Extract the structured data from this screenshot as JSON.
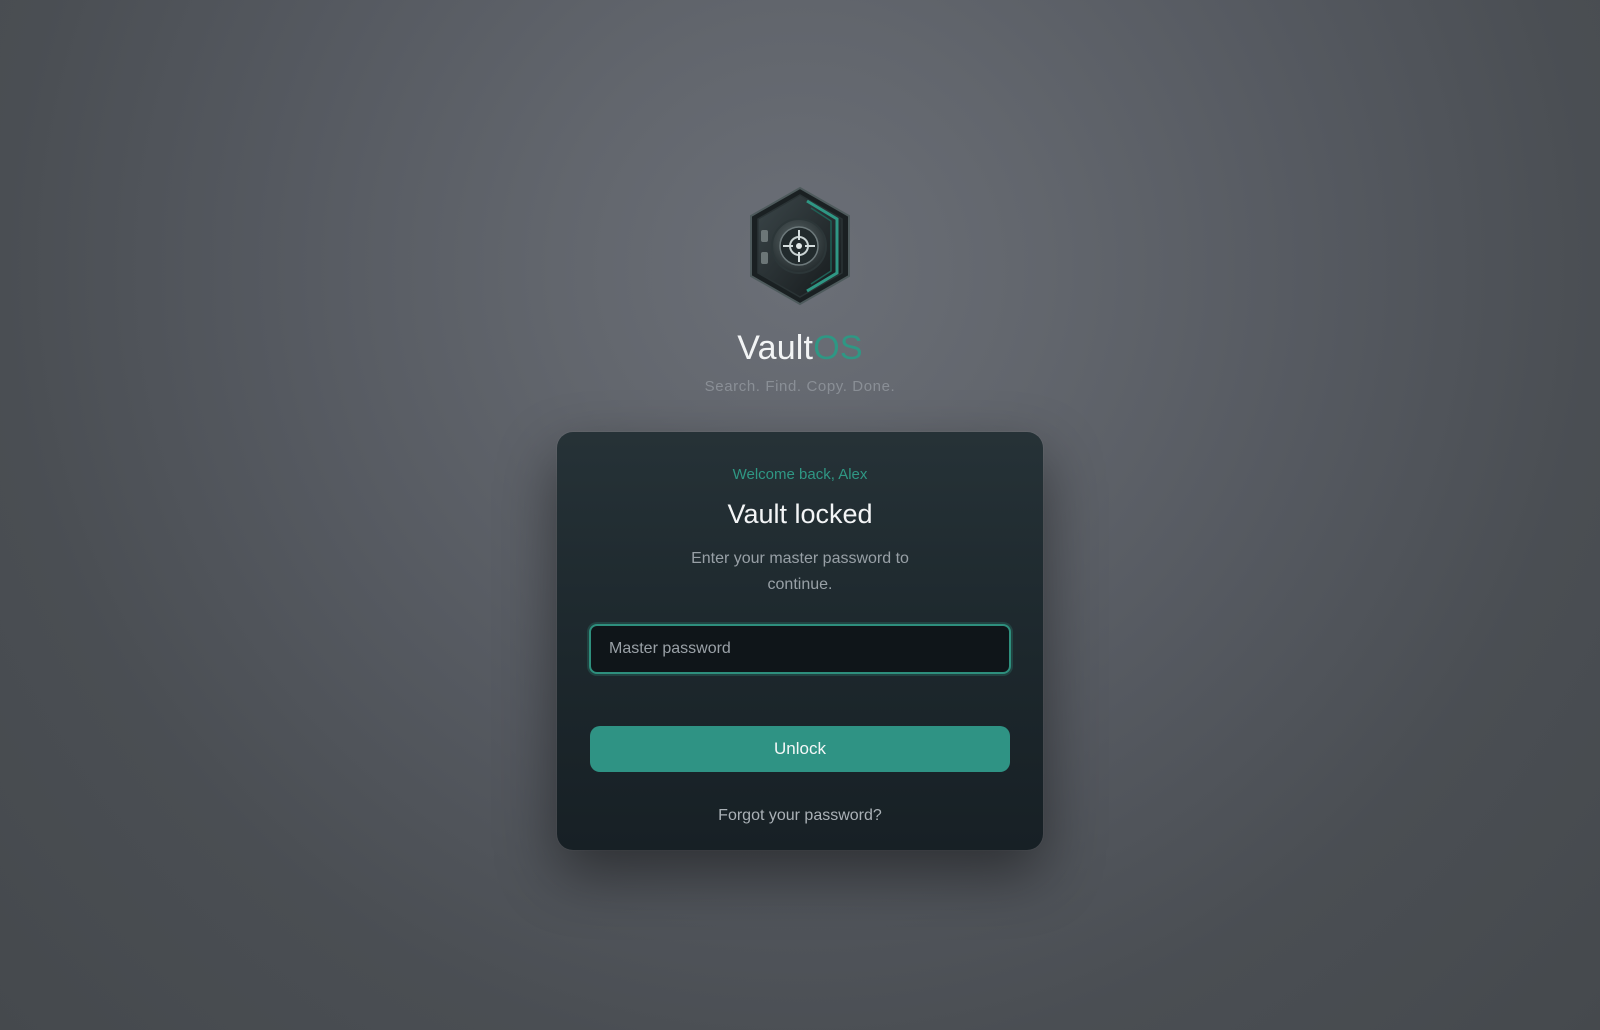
{
  "brand": {
    "name_primary": "Vault",
    "name_accent": "OS",
    "tagline": "Search. Find. Copy. Done.",
    "logo_icon": "vault-safe-hexagon-icon"
  },
  "unlock_card": {
    "welcome": "Welcome back, Alex",
    "title": "Vault locked",
    "description": "Enter your master password to continue.",
    "password_placeholder": "Master password",
    "password_value": "",
    "unlock_label": "Unlock",
    "forgot_label": "Forgot your password?"
  },
  "colors": {
    "accent": "#2f9784",
    "button": "#2f9384",
    "card_top": "#263237",
    "card_bottom": "#172025",
    "input_bg": "#0f1519"
  }
}
